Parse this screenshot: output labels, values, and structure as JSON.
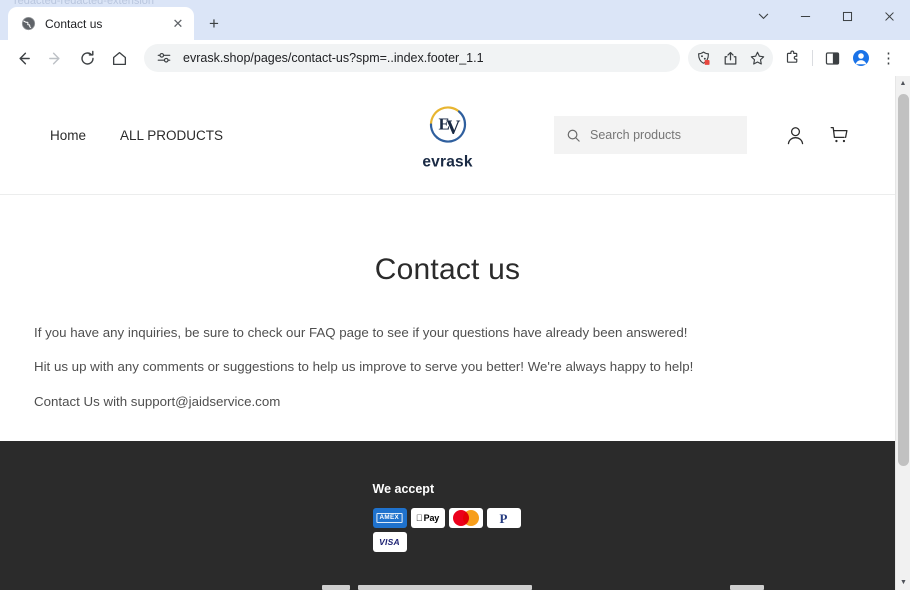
{
  "browser": {
    "ghost_text": "redacted-redacted-extension",
    "tab": {
      "title": "Contact us",
      "favicon_name": "globe-icon",
      "close_label": "✕"
    },
    "new_tab_label": "+",
    "window_controls": {
      "tab_search": "⌄",
      "minimize": "—",
      "maximize": "□",
      "close": "✕"
    },
    "toolbar": {
      "back_label": "←",
      "forward_label": "→",
      "reload_label": "↻",
      "home_label": "⌂",
      "url": "evrask.shop/pages/contact-us?spm=..index.footer_1.1",
      "site_info_name": "site-settings-icon",
      "tracking_icon_name": "tracking-protection-icon",
      "share_icon_name": "share-icon",
      "bookmark_icon_name": "star-icon",
      "extensions_icon_name": "puzzle-extensions-icon",
      "split_view_icon_name": "split-view-icon",
      "profile_icon_name": "profile-avatar-icon",
      "menu_label": "⋮"
    }
  },
  "site": {
    "nav": [
      {
        "label": "Home"
      },
      {
        "label": "ALL PRODUCTS"
      }
    ],
    "logo": {
      "wordmark": "evrask",
      "monogram": "EV",
      "arc_top_color": "#e8b530",
      "arc_bottom_color": "#2f5f9e"
    },
    "search": {
      "placeholder": "Search products",
      "value": "",
      "icon_name": "search-icon"
    },
    "account_icon_name": "user-account-icon",
    "cart_icon_name": "shopping-cart-icon"
  },
  "main": {
    "title": "Contact us",
    "paragraphs": [
      "If you have any inquiries, be sure to check our FAQ page to see if your questions have already been answered!",
      "Hit us up with any comments or suggestions to help us improve to serve you better! We're always happy to help!",
      "Contact Us with support@jaidservice.com"
    ]
  },
  "footer": {
    "we_accept_title": "We accept",
    "background_color": "#2b2b2b",
    "payment_methods": [
      {
        "name": "american-express",
        "label": "AMEX",
        "bg": "#1f72cd"
      },
      {
        "name": "apple-pay",
        "label": "Pay",
        "bg": "#ffffff"
      },
      {
        "name": "mastercard",
        "label": "",
        "bg": "#ffffff"
      },
      {
        "name": "paypal",
        "label": "P",
        "bg": "#ffffff"
      },
      {
        "name": "visa",
        "label": "VISA",
        "bg": "#ffffff"
      }
    ]
  },
  "scrollbar": {
    "up_arrow": "▲",
    "down_arrow": "▼"
  }
}
